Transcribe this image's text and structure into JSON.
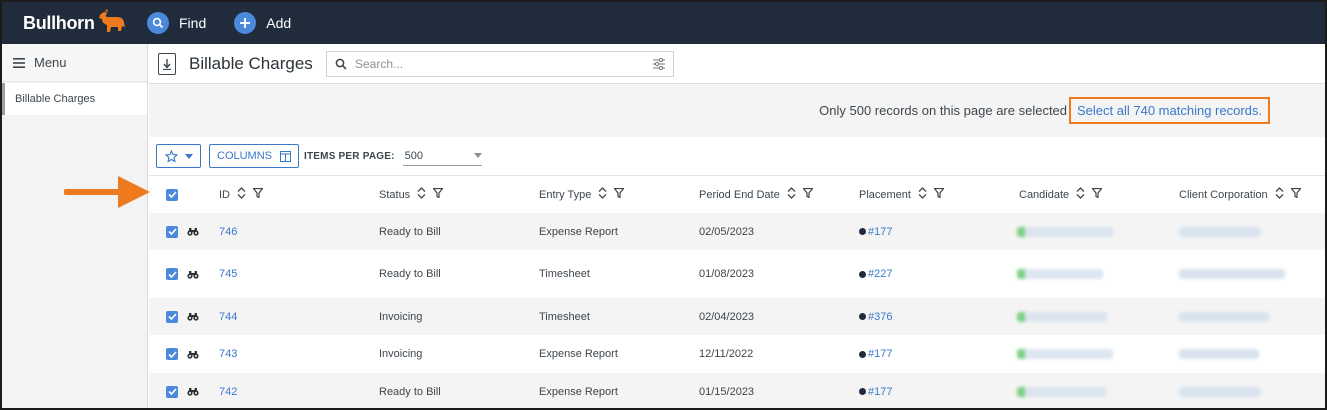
{
  "app": {
    "brand": "Bullhorn"
  },
  "nav": {
    "find_label": "Find",
    "add_label": "Add"
  },
  "sidebar": {
    "menu_label": "Menu",
    "items": [
      {
        "label": "Billable Charges"
      }
    ]
  },
  "header": {
    "title": "Billable Charges",
    "search_placeholder": "Search..."
  },
  "banner": {
    "message": "Only 500 records on this page are selected",
    "select_all_link": "Select all 740 matching records."
  },
  "toolbar": {
    "columns_label": "COLUMNS",
    "items_per_page_label": "ITEMS PER PAGE:",
    "items_per_page_value": "500"
  },
  "table": {
    "columns": [
      "ID",
      "Status",
      "Entry Type",
      "Period End Date",
      "Placement",
      "Candidate",
      "Client Corporation"
    ],
    "rows": [
      {
        "id": "746",
        "status": "Ready to Bill",
        "entry_type": "Expense Report",
        "period_end": "02/05/2023",
        "placement": "#177"
      },
      {
        "id": "745",
        "status": "Ready to Bill",
        "entry_type": "Timesheet",
        "period_end": "01/08/2023",
        "placement": "#227"
      },
      {
        "id": "744",
        "status": "Invoicing",
        "entry_type": "Timesheet",
        "period_end": "02/04/2023",
        "placement": "#376"
      },
      {
        "id": "743",
        "status": "Invoicing",
        "entry_type": "Expense Report",
        "period_end": "12/11/2022",
        "placement": "#177"
      },
      {
        "id": "742",
        "status": "Ready to Bill",
        "entry_type": "Expense Report",
        "period_end": "01/15/2023",
        "placement": "#177"
      }
    ]
  },
  "colors": {
    "nav_bg": "#202b3c",
    "accent": "#3a78c8",
    "highlight": "#ee7a1f",
    "checkbox": "#4a89dc"
  }
}
